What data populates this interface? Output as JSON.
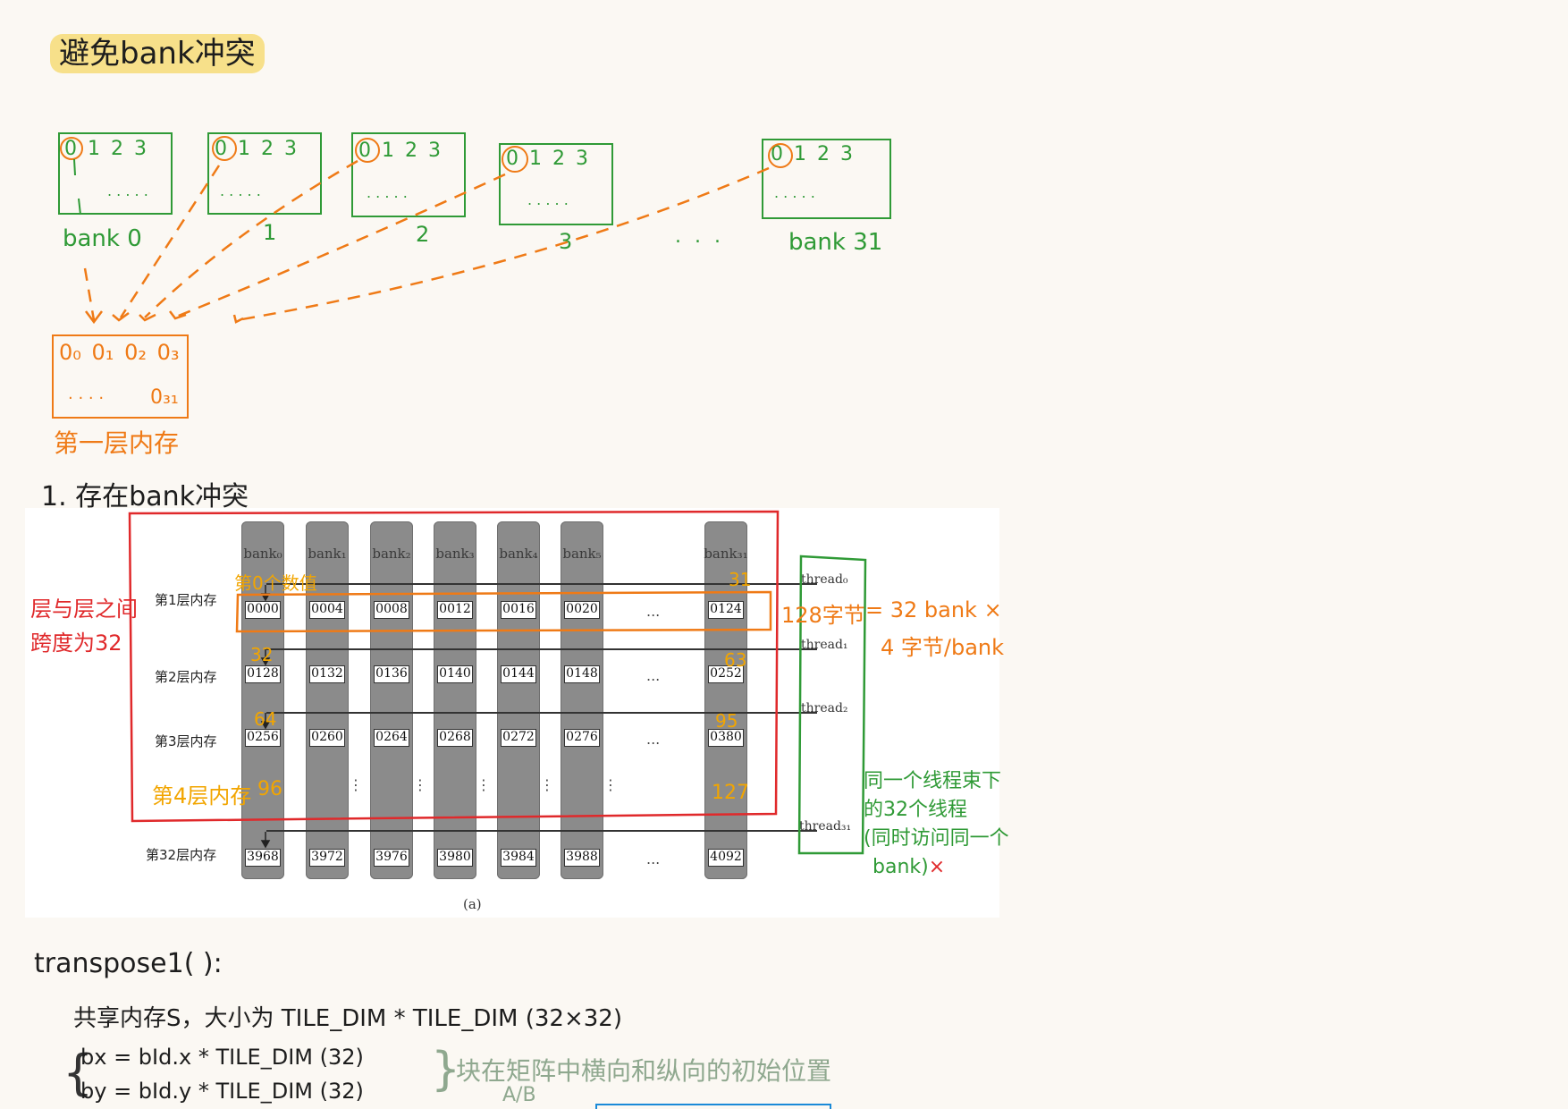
{
  "heading": "避免bank冲突",
  "banks_diagram": {
    "bank_label_0": "bank 0",
    "bank_label_1": "1",
    "bank_label_2": "2",
    "bank_label_3": "3",
    "ellipsis": ". . .",
    "bank_label_31": "bank 31",
    "digits": [
      "0",
      "1",
      "2",
      "3"
    ],
    "box_dash": ". . . . .",
    "layer_row1": [
      "0₀",
      "0₁",
      "0₂",
      "0₃"
    ],
    "layer_row2_dash": ". . . .",
    "layer_row2_end": "0₃₁",
    "layer_caption": "第一层内存"
  },
  "section1": "1. 存在bank冲突",
  "figure": {
    "banks": [
      "bank₀",
      "bank₁",
      "bank₂",
      "bank₃",
      "bank₄",
      "bank₅",
      "bank₃₁"
    ],
    "rows": [
      {
        "label": "第1层内存",
        "cells": [
          "0000",
          "0004",
          "0008",
          "0012",
          "0016",
          "0020",
          "0124"
        ]
      },
      {
        "label": "第2层内存",
        "cells": [
          "0128",
          "0132",
          "0136",
          "0140",
          "0144",
          "0148",
          "0252"
        ]
      },
      {
        "label": "第3层内存",
        "cells": [
          "0256",
          "0260",
          "0264",
          "0268",
          "0272",
          "0276",
          "0380"
        ]
      },
      {
        "label": "第32层内存",
        "cells": [
          "3968",
          "3972",
          "3976",
          "3980",
          "3984",
          "3988",
          "4092"
        ]
      }
    ],
    "threads": [
      "thread₀",
      "thread₁",
      "thread₂",
      "thread₃₁"
    ],
    "caption": "(a)",
    "ellipsis": "...",
    "vdots": "⋮"
  },
  "annotations": {
    "left_red_1": "层与层之间",
    "left_red_2": "跨度为32",
    "first_value": "第0个数值",
    "n31": "31",
    "n32": "32",
    "n63": "63",
    "n64": "64",
    "n95": "95",
    "layer4": "第4层内存",
    "n96": "96",
    "n127": "127",
    "bytes_128": "128字节",
    "eq_line1": "= 32 bank ×",
    "eq_line2": "4 字节/bank",
    "green_1": "同一个线程束下",
    "green_2": "的32个线程",
    "green_3": "(同时访问同一个",
    "green_4": "bank)",
    "red_x": "×"
  },
  "code": {
    "fn": "transpose1(  ):",
    "line1": "共享内存S，大小为 TILE_DIM *  TILE_DIM (32×32)",
    "line2": "bx = bId.x  *  TILE_DIM (32)",
    "line3": "by = bId.y  *   TILE_DIM (32)",
    "brace_left": "{",
    "brace_right": "}",
    "note": "块在矩阵中横向和纵向的初始位置",
    "note_sub": "A/B"
  },
  "colors": {
    "green": "#2f9a36",
    "orange": "#ef7a16",
    "red": "#e0292b",
    "yellow": "#f2a500",
    "highlight": "#f7e08a"
  }
}
